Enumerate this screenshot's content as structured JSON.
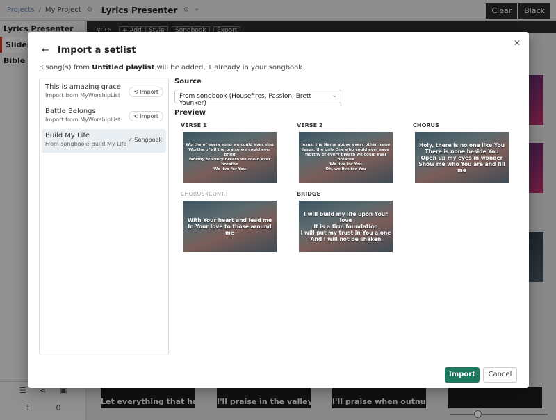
{
  "topbar": {
    "breadcrumb_projects": "Projects",
    "breadcrumb_sep": "/",
    "breadcrumb_project": "My Project",
    "app_title": "Lyrics Presenter",
    "clear_label": "Clear",
    "black_label": "Black"
  },
  "nav": {
    "items": [
      {
        "label": "Lyrics Presenter"
      },
      {
        "label": "Slides"
      },
      {
        "label": "Bible"
      }
    ],
    "counter_left": "1",
    "counter_right": "0"
  },
  "darkbar": {
    "lyrics": "Lyrics",
    "add": "+ Add",
    "style": "Style",
    "songbook": "Songbook",
    "export": "Export"
  },
  "background_slides": {
    "bottom": [
      "Let everything that has breath",
      "I'll praise in the valley",
      "I'll praise when outnumbered",
      ""
    ]
  },
  "modal": {
    "title": "Import a setlist",
    "summary_prefix": "3 song(s) from ",
    "summary_playlist": "Untitled playlist",
    "summary_suffix": " will be added, 1 already in your songbook.",
    "songs": [
      {
        "title": "This is amazing grace",
        "subtitle": "Import from MyWorshipList",
        "action": "Import"
      },
      {
        "title": "Battle Belongs",
        "subtitle": "Import from MyWorshipList",
        "action": "Import"
      },
      {
        "title": "Build My Life",
        "subtitle": "From songbook: Build My Life",
        "action": "✓ Songbook"
      }
    ],
    "source_label": "Source",
    "source_value": "From songbook (Housefires, Passion, Brett Younker)",
    "preview_label": "Preview",
    "slides": [
      {
        "label": "VERSE 1",
        "text": "Worthy of every song we could ever sing\nWorthy of all the praise we could ever bring\nWorthy of every breath we could ever breathe\nWe live for You"
      },
      {
        "label": "VERSE 2",
        "text": "Jesus, the Name above every other name\nJesus, the only One who could ever save\nWorthy of every breath we could ever breathe\nWe live for You\nOh, we live for You"
      },
      {
        "label": "CHORUS",
        "text": "Holy, there is no one like You\nThere is none beside You\nOpen up my eyes in wonder\nShow me who You are and fill me"
      },
      {
        "label": "CHORUS (CONT.)",
        "text": "With Your heart and lead me\nIn Your love to those around me"
      },
      {
        "label": "BRIDGE",
        "text": "I will build my life upon Your love\nIt is a firm foundation\nI will put my trust in You alone\nAnd I will not be shaken"
      }
    ],
    "import_button": "Import",
    "cancel_button": "Cancel"
  },
  "colors": {
    "primary": "#1e7a5e",
    "nav_active_accent": "#c0392b"
  }
}
